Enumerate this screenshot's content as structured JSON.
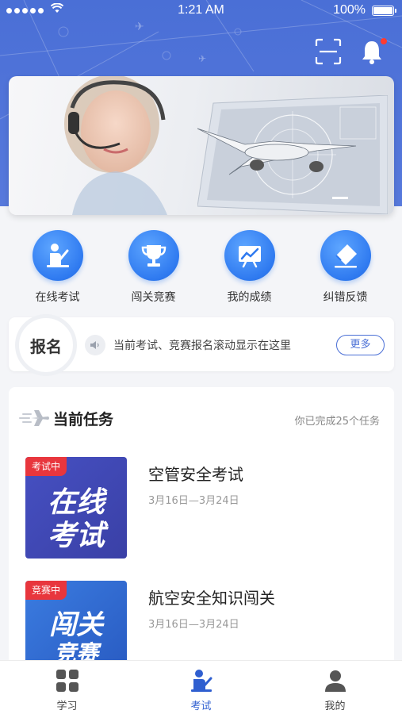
{
  "status_bar": {
    "time": "1:21 AM",
    "battery": "100%"
  },
  "menu": [
    {
      "label": "在线考试",
      "icon": "person-desk-icon"
    },
    {
      "label": "闯关竞赛",
      "icon": "trophy-icon"
    },
    {
      "label": "我的成绩",
      "icon": "chart-board-icon"
    },
    {
      "label": "纠错反馈",
      "icon": "eraser-icon"
    }
  ],
  "enroll": {
    "badge": "报名",
    "marquee": "当前考试、竞赛报名滚动显示在这里",
    "more": "更多"
  },
  "tasks": {
    "title": "当前任务",
    "count": "你已完成25个任务",
    "items": [
      {
        "tag": "考试中",
        "thumb_line1": "在线",
        "thumb_line2": "考试",
        "name": "空管安全考试",
        "date": "3月16日—3月24日",
        "color": "#3f4ab8"
      },
      {
        "tag": "竞赛中",
        "thumb_line1": "闯关",
        "thumb_line2": "竞赛",
        "name": "航空安全知识闯关",
        "date": "3月16日—3月24日",
        "color": "#2f6fd8"
      }
    ]
  },
  "tabbar": [
    {
      "label": "学习",
      "icon": "grid-icon",
      "active": false
    },
    {
      "label": "考试",
      "icon": "exam-person-icon",
      "active": true
    },
    {
      "label": "我的",
      "icon": "user-icon",
      "active": false
    }
  ]
}
